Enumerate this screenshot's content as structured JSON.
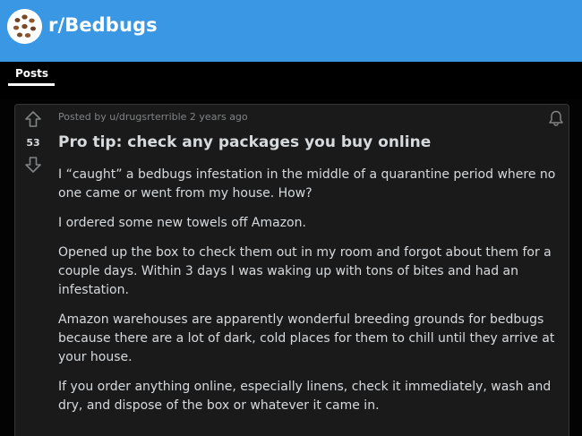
{
  "header": {
    "subreddit": "r/Bedbugs",
    "accent_color": "#3a97e3"
  },
  "tabs": [
    {
      "label": "Posts",
      "active": true
    }
  ],
  "post": {
    "score": "53",
    "meta": "Posted by u/drugsrterrible 2 years ago",
    "title": "Pro tip: check any packages you buy online",
    "paragraphs": [
      "I “caught” a bedbugs infestation in the middle of a quarantine period where no one came or went from my house. How?",
      "I ordered some new towels off Amazon.",
      "Opened up the box to check them out in my room and forgot about them for a couple days. Within 3 days I was waking up with tons of bites and had an infestation.",
      "Amazon warehouses are apparently wonderful breeding grounds for bedbugs because there are a lot of dark, cold places for them to chill until they arrive at your house.",
      "If you order anything online, especially linens, check it immediately, wash and dry, and dispose of the box or whatever it came in."
    ]
  },
  "icons": {
    "subreddit": "subreddit-avatar-icon",
    "upvote": "upvote-arrow-icon",
    "downvote": "downvote-arrow-icon",
    "follow": "bell-icon"
  }
}
